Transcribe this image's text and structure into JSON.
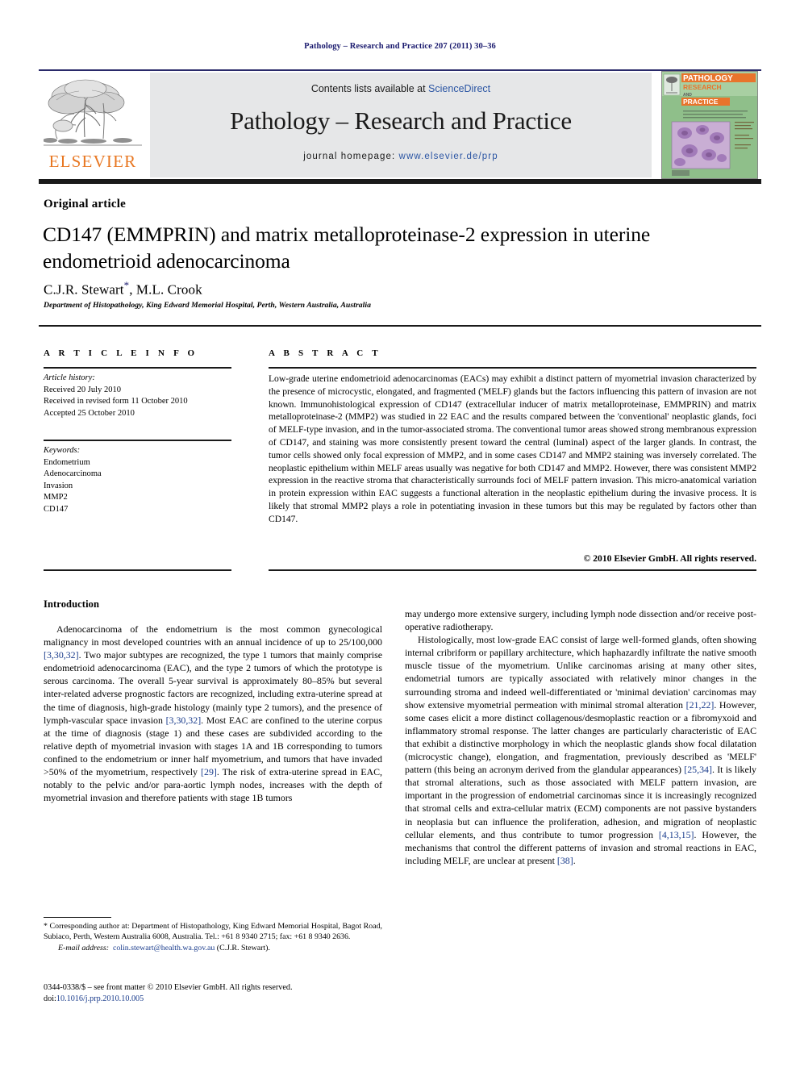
{
  "running_head": "Pathology – Research and Practice 207 (2011) 30–36",
  "masthead": {
    "contents_prefix": "Contents lists available at ",
    "contents_link": "ScienceDirect",
    "journal_title": "Pathology – Research and Practice",
    "homepage_prefix": "journal homepage: ",
    "homepage_url": "www.elsevier.de/prp",
    "publisher_logo_text": "ELSEVIER",
    "cover": {
      "line1": "PATHOLOGY",
      "line2": "RESEARCH",
      "line3": "AND",
      "line4": "PRACTICE"
    }
  },
  "article": {
    "kind": "Original article",
    "title": "CD147 (EMMPRIN) and matrix metalloproteinase-2 expression in uterine endometrioid adenocarcinoma",
    "authors": "C.J.R. Stewart",
    "authors_rest": ", M.L. Crook",
    "author_marker": "*",
    "affiliation": "Department of Histopathology, King Edward Memorial Hospital, Perth, Western Australia, Australia"
  },
  "info": {
    "header": "A R T I C L E   I N F O",
    "history_label": "Article history:",
    "history": [
      "Received 20 July 2010",
      "Received in revised form 11 October 2010",
      "Accepted 25 October 2010"
    ],
    "keywords_label": "Keywords:",
    "keywords": [
      "Endometrium",
      "Adenocarcinoma",
      "Invasion",
      "MMP2",
      "CD147"
    ]
  },
  "abstract": {
    "header": "A B S T R A C T",
    "text": "Low-grade uterine endometrioid adenocarcinomas (EACs) may exhibit a distinct pattern of myometrial invasion characterized by the presence of microcystic, elongated, and fragmented ('MELF) glands but the factors influencing this pattern of invasion are not known. Immunohistological expression of CD147 (extracellular inducer of matrix metalloproteinase, EMMPRIN) and matrix metalloproteinase-2 (MMP2) was studied in 22 EAC and the results compared between the 'conventional' neoplastic glands, foci of MELF-type invasion, and in the tumor-associated stroma. The conventional tumor areas showed strong membranous expression of CD147, and staining was more consistently present toward the central (luminal) aspect of the larger glands. In contrast, the tumor cells showed only focal expression of MMP2, and in some cases CD147 and MMP2 staining was inversely correlated. The neoplastic epithelium within MELF areas usually was negative for both CD147 and MMP2. However, there was consistent MMP2 expression in the reactive stroma that characteristically surrounds foci of MELF pattern invasion. This micro-anatomical variation in protein expression within EAC suggests a functional alteration in the neoplastic epithelium during the invasive process. It is likely that stromal MMP2 plays a role in potentiating invasion in these tumors but this may be regulated by factors other than CD147.",
    "copyright": "© 2010 Elsevier GmbH. All rights reserved."
  },
  "body": {
    "intro_heading": "Introduction",
    "left_p1_a": "Adenocarcinoma of the endometrium is the most common gynecological malignancy in most developed countries with an annual incidence of up to 25/100,000 ",
    "left_p1_ref1": "[3,30,32]",
    "left_p1_b": ". Two major subtypes are recognized, the type 1 tumors that mainly comprise endometrioid adenocarcinoma (EAC), and the type 2 tumors of which the prototype is serous carcinoma. The overall 5-year survival is approximately 80–85% but several inter-related adverse prognostic factors are recognized, including extra-uterine spread at the time of diagnosis, high-grade histology (mainly type 2 tumors), and the presence of lymph-vascular space invasion ",
    "left_p1_ref2": "[3,30,32]",
    "left_p1_c": ". Most EAC are confined to the uterine corpus at the time of diagnosis (stage 1) and these cases are subdivided according to the relative depth of myometrial invasion with stages 1A and 1B corresponding to tumors confined to the endometrium or inner half myometrium, and tumors that have invaded >50% of the myometrium, respectively ",
    "left_p1_ref3": "[29]",
    "left_p1_d": ". The risk of extra-uterine spread in EAC, notably to the pelvic and/or para-aortic lymph nodes, increases with the depth of myometrial invasion and therefore patients with stage 1B tumors",
    "right_p0": "may undergo more extensive surgery, including lymph node dissection and/or receive post-operative radiotherapy.",
    "right_p1_a": "Histologically, most low-grade EAC consist of large well-formed glands, often showing internal cribriform or papillary architecture, which haphazardly infiltrate the native smooth muscle tissue of the myometrium. Unlike carcinomas arising at many other sites, endometrial tumors are typically associated with relatively minor changes in the surrounding stroma and indeed well-differentiated or 'minimal deviation' carcinomas may show extensive myometrial permeation with minimal stromal alteration ",
    "right_p1_ref1": "[21,22]",
    "right_p1_b": ". However, some cases elicit a more distinct collagenous/desmoplastic reaction or a fibromyxoid and inflammatory stromal response. The latter changes are particularly characteristic of EAC that exhibit a distinctive morphology in which the neoplastic glands show focal dilatation (microcystic change), elongation, and fragmentation, previously described as 'MELF' pattern (this being an acronym derived from the glandular appearances) ",
    "right_p1_ref2": "[25,34]",
    "right_p1_c": ". It is likely that stromal alterations, such as those associated with MELF pattern invasion, are important in the progression of endometrial carcinomas since it is increasingly recognized that stromal cells and extra-cellular matrix (ECM) components are not passive bystanders in neoplasia but can influence the proliferation, adhesion, and migration of neoplastic cellular elements, and thus contribute to tumor progression ",
    "right_p1_ref3": "[4,13,15]",
    "right_p1_d": ". However, the mechanisms that control the different patterns of invasion and stromal reactions in EAC, including MELF, are unclear at present ",
    "right_p1_ref4": "[38]",
    "right_p1_e": "."
  },
  "footer": {
    "corr_marker": "*",
    "corr_text": " Corresponding author at: Department of Histopathology, King Edward Memorial Hospital, Bagot Road, Subiaco, Perth, Western Australia 6008, Australia. Tel.: +61 8 9340 2715; fax: +61 8 9340 2636.",
    "email_label": "E-mail address:",
    "email": "colin.stewart@health.wa.gov.au",
    "email_suffix": " (C.J.R. Stewart).",
    "issn_line": "0344-0338/$ – see front matter © 2010 Elsevier GmbH. All rights reserved.",
    "doi_label": "doi:",
    "doi": "10.1016/j.prp.2010.10.005"
  },
  "colors": {
    "runhead": "#1a1a6e",
    "link": "#2b55a3",
    "reference": "#1a3c8c",
    "elsevier_orange": "#E87722",
    "band": "#e6e7e8",
    "cover_green": "#7fb069"
  }
}
